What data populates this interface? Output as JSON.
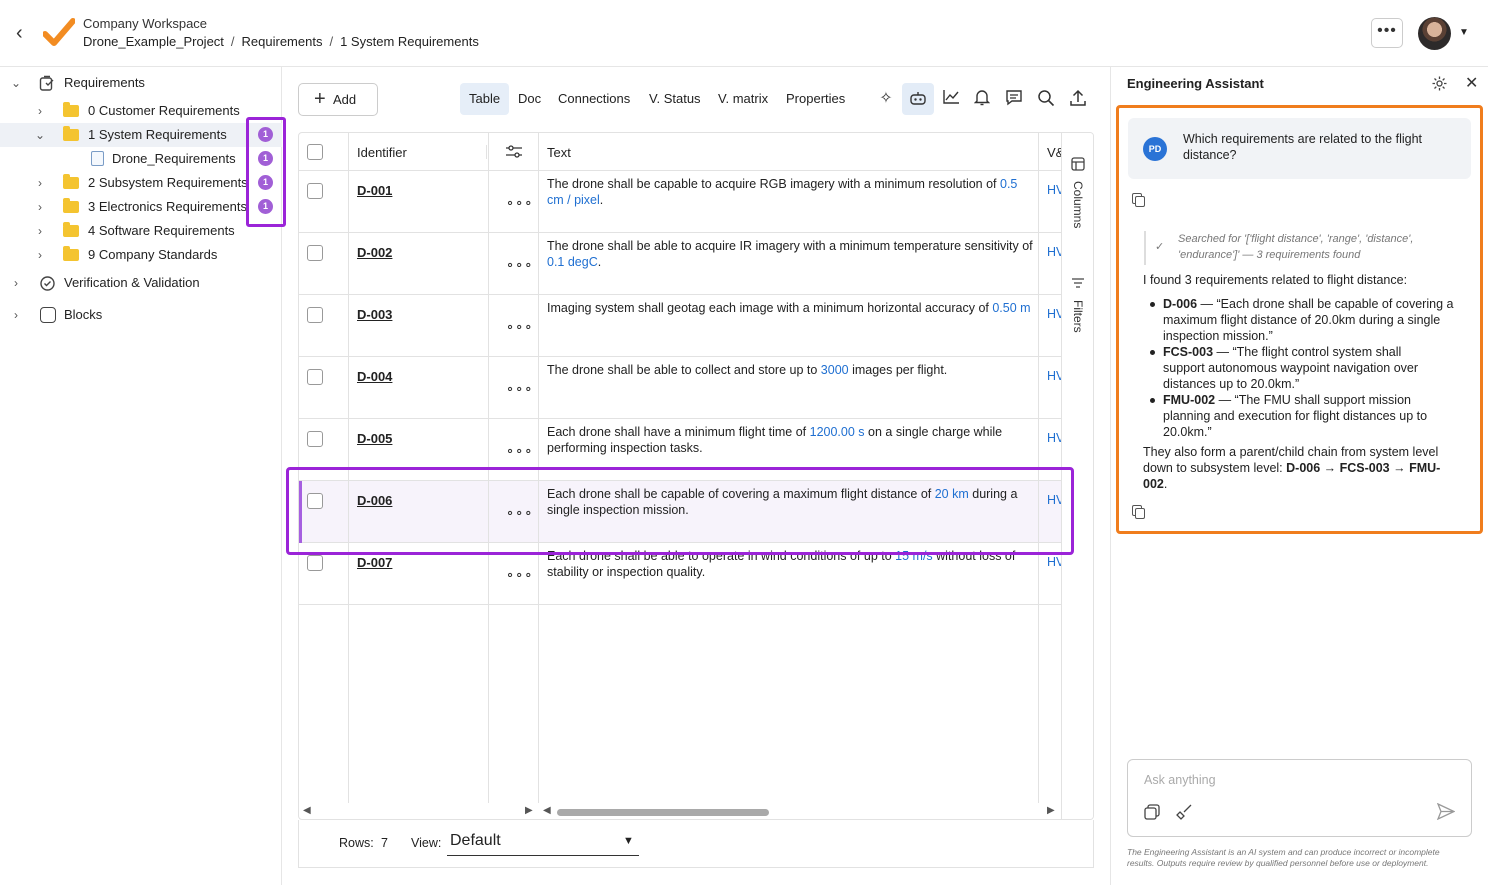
{
  "header": {
    "workspace": "Company Workspace",
    "breadcrumbs": [
      "Drone_Example_Project",
      "Requirements",
      "1 System Requirements"
    ],
    "more_label": "•••"
  },
  "sidebar": {
    "items": [
      {
        "label": "Requirements",
        "icon": "requirements-icon"
      },
      {
        "label": "0 Customer Requirements"
      },
      {
        "label": "1 System Requirements",
        "badge": "1"
      },
      {
        "label": "Drone_Requirements",
        "badge": "1"
      },
      {
        "label": "2 Subsystem Requirements",
        "badge": "1"
      },
      {
        "label": "3 Electronics Requirements",
        "badge": "1"
      },
      {
        "label": "4 Software Requirements"
      },
      {
        "label": "9 Company Standards"
      },
      {
        "label": "Verification & Validation"
      },
      {
        "label": "Blocks"
      }
    ]
  },
  "toolbar": {
    "add_label": "Add",
    "tabs": [
      "Table",
      "Doc",
      "Connections",
      "V. Status",
      "V. matrix",
      "Properties"
    ]
  },
  "table": {
    "headers": {
      "identifier": "Identifier",
      "text": "Text",
      "v": "V&"
    },
    "rows": [
      {
        "id": "D-001",
        "t1": "The drone shall be capable to acquire RGB imagery with a minimum resolution of ",
        "v": "0.5  cm / pixel",
        "t2": ".",
        "hv": "HV"
      },
      {
        "id": "D-002",
        "t1": "The drone shall be able to acquire IR imagery with a minimum temperature sensitivity of ",
        "v": "0.1  degC",
        "t2": ".",
        "hv": "HV"
      },
      {
        "id": "D-003",
        "t1": "Imaging system shall geotag each image with a minimum horizontal accuracy of ",
        "v": "0.50  m",
        "t2": "",
        "hv": "HV"
      },
      {
        "id": "D-004",
        "t1": "The drone shall be able to collect and store up to ",
        "v": "3000",
        "t2": " images per flight.",
        "hv": "HV"
      },
      {
        "id": "D-005",
        "t1": "Each drone shall have a minimum flight time of ",
        "v": "1200.00  s",
        "t2": " on a single charge while performing inspection tasks.",
        "hv": "HV"
      },
      {
        "id": "D-006",
        "t1": "Each drone shall be capable of covering a maximum flight distance of ",
        "v": "20  km",
        "t2": " during a single inspection mission.",
        "hv": "HV"
      },
      {
        "id": "D-007",
        "t1": "Each drone shall be able to operate in wind conditions of up to ",
        "v": "15  m/s",
        "t2": " without loss of stability or inspection quality.",
        "hv": "HV"
      }
    ],
    "side_tabs": {
      "columns": "Columns",
      "filters": "Filters"
    }
  },
  "footer": {
    "rows_label": "Rows:",
    "rows_value": "7",
    "view_label": "View:",
    "view_value": "Default"
  },
  "assistant": {
    "title": "Engineering Assistant",
    "user_initials": "PD",
    "question": "Which requirements are related to the flight distance?",
    "search_note": "Searched for '['flight distance', 'range', 'distance', 'endurance']' — 3 requirements found",
    "intro": "I found 3 requirements related to flight distance:",
    "results": [
      {
        "id": "D-006",
        "text": " — “Each drone shall be capable of covering a maximum flight distance of 20.0km during a single inspection mission.”"
      },
      {
        "id": "FCS-003",
        "text": " — “The flight control system shall support autonomous waypoint navigation over distances up to 20.0km.”"
      },
      {
        "id": "FMU-002",
        "text": " — “The FMU shall support mission planning and execution for flight distances up to 20.0km.”"
      }
    ],
    "summary_a": "They also form a parent/child chain from system level down to subsystem level: ",
    "summary_chain": "D-006 → FCS-003 → FMU-002",
    "summary_end": ".",
    "ask_placeholder": "Ask anything",
    "disclaimer": "The Engineering Assistant is an AI system and can produce incorrect or incomplete results. Outputs require review by qualified personnel before use or deployment."
  },
  "colors": {
    "accent": "#1f6fd1",
    "highlight": "#9b24d8",
    "assistant_box": "#f07d1d",
    "badge": "#a15fd6"
  }
}
